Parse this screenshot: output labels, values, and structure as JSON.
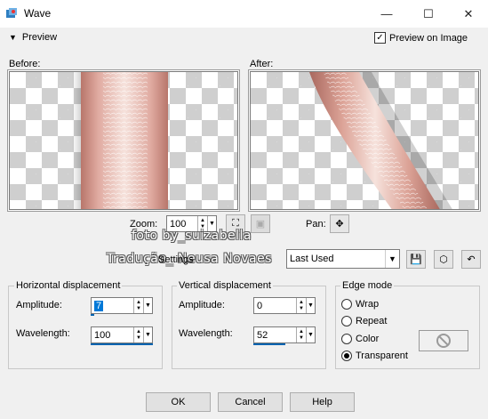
{
  "window": {
    "title": "Wave",
    "minimize_glyph": "—",
    "maximize_glyph": "☐",
    "close_glyph": "✕"
  },
  "preview": {
    "toggle_label": "Preview",
    "preview_on_image_label": "Preview on Image",
    "preview_on_image_checked": true,
    "before_label": "Before:",
    "after_label": "After:"
  },
  "zoom": {
    "label": "Zoom:",
    "value": "100"
  },
  "pan": {
    "label": "Pan:"
  },
  "watermark": {
    "line1": "foto by_suizabella",
    "line2": "Tradução_ Neusa Novaes"
  },
  "settings": {
    "label": "Settings",
    "selected": "Last Used"
  },
  "horizontal": {
    "title": "Horizontal displacement",
    "amplitude_label": "Amplitude:",
    "amplitude_value": "7",
    "wavelength_label": "Wavelength:",
    "wavelength_value": "100"
  },
  "vertical": {
    "title": "Vertical displacement",
    "amplitude_label": "Amplitude:",
    "amplitude_value": "0",
    "wavelength_label": "Wavelength:",
    "wavelength_value": "52"
  },
  "edge_mode": {
    "title": "Edge mode",
    "options": [
      "Wrap",
      "Repeat",
      "Color",
      "Transparent"
    ],
    "selected": "Transparent"
  },
  "buttons": {
    "ok": "OK",
    "cancel": "Cancel",
    "help": "Help"
  },
  "colors": {
    "accent": "#0063b1",
    "texture_base": "#d49a90",
    "texture_light": "#f3dcd6"
  }
}
